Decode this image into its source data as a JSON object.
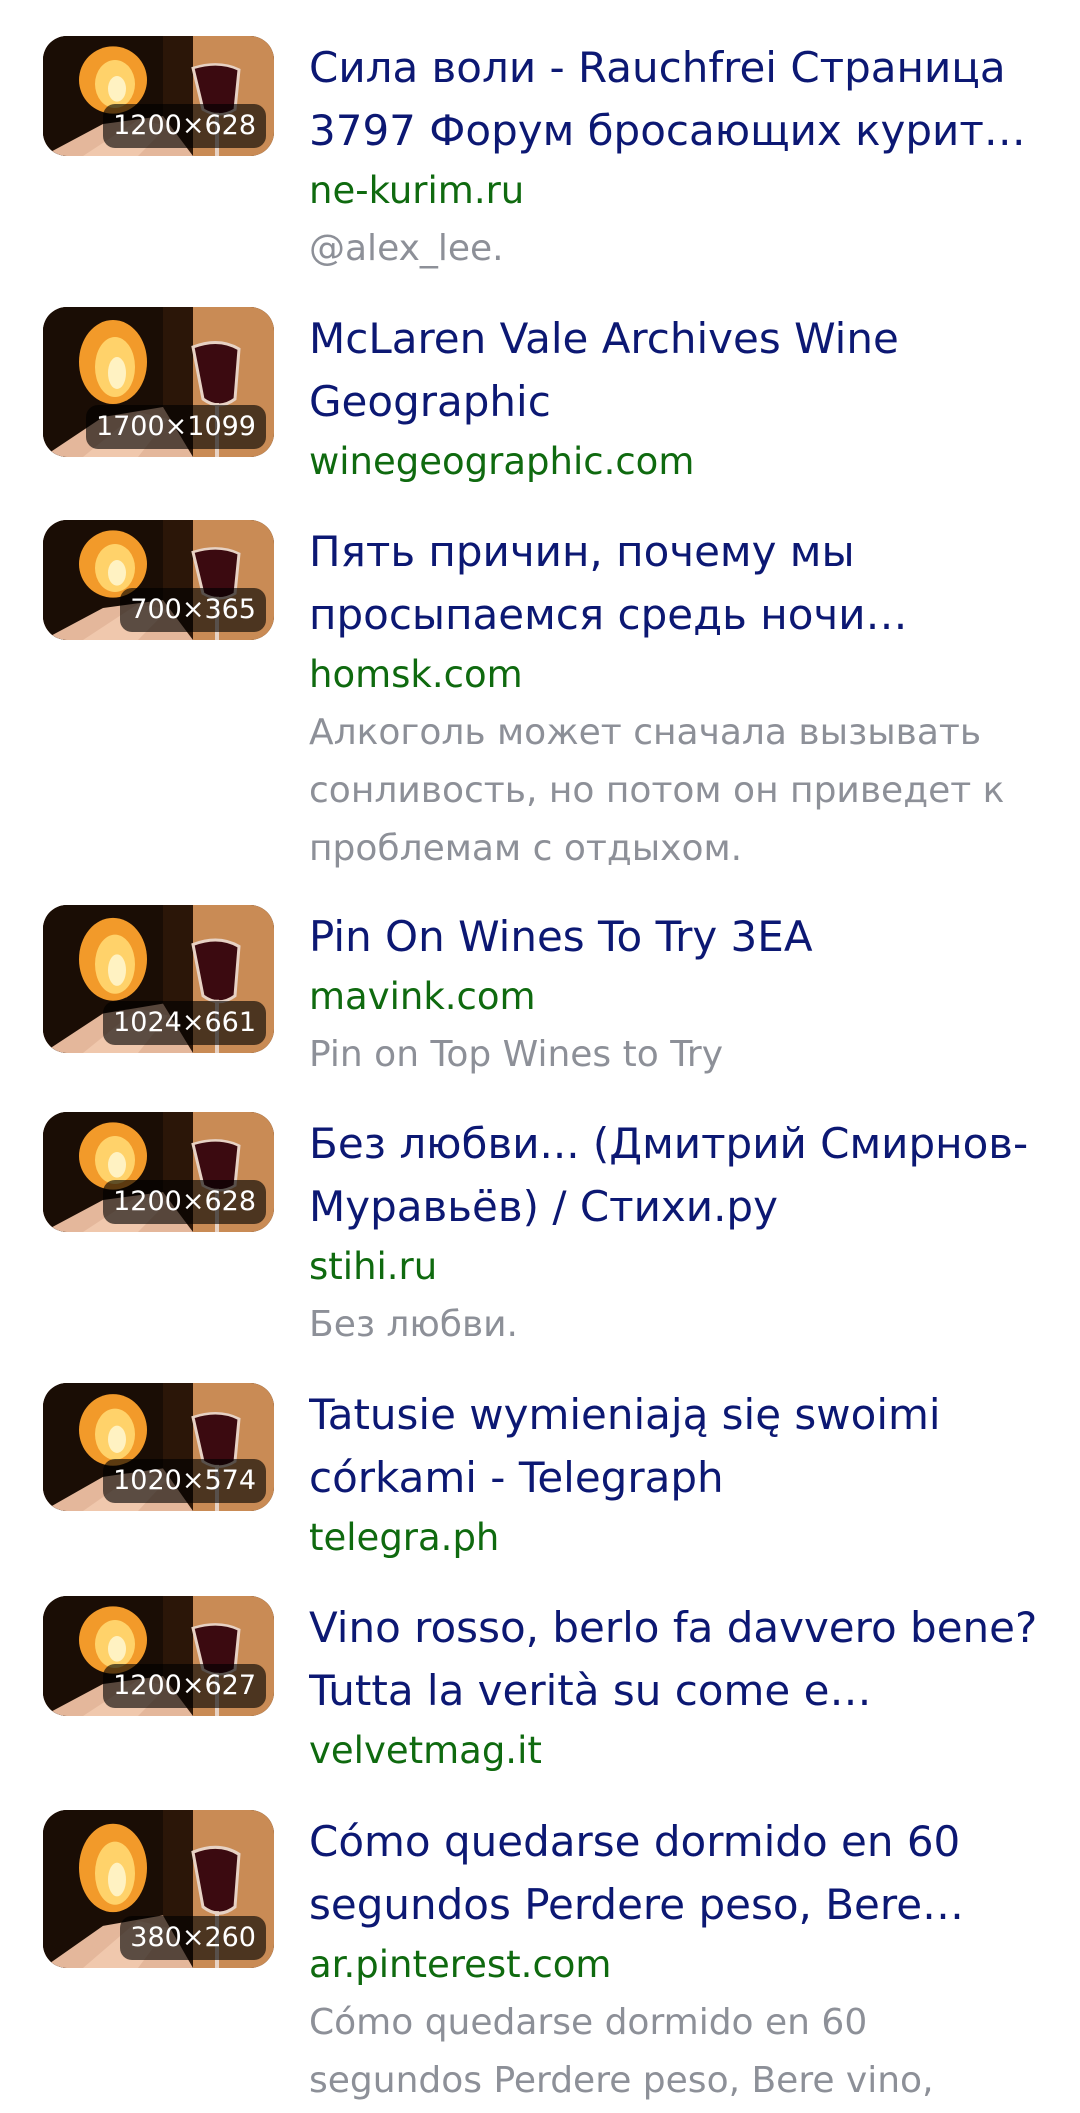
{
  "results": [
    {
      "title": "Сила воли - Rauchfrei Страница 3797 Форум бросающих курит…",
      "domain": "ne-kurim.ru",
      "description": "@alex_lee.",
      "dimensions": "1200×628"
    },
    {
      "title": "McLaren Vale Archives Wine Geographic",
      "domain": "winegeographic.com",
      "description": "",
      "dimensions": "1700×1099"
    },
    {
      "title": "Пять причин, почему мы просыпаемся средь ночи…",
      "domain": "homsk.com",
      "description": "Алкоголь может сначала вызывать сонливость, но потом он приведет к проблемам с отдыхом.",
      "dimensions": "700×365"
    },
    {
      "title": "Pin On Wines To Try 3EA",
      "domain": "mavink.com",
      "description": "Pin on Top Wines to Try",
      "dimensions": "1024×661"
    },
    {
      "title": "Без любви... (Дмитрий Смирнов-Муравьёв) / Стихи.ру",
      "domain": "stihi.ru",
      "description": "Без любви.",
      "dimensions": "1200×628"
    },
    {
      "title": "Tatusie wymieniają się swoimi córkami - Telegraph",
      "domain": "telegra.ph",
      "description": "",
      "dimensions": "1020×574"
    },
    {
      "title": "Vino rosso, berlo fa davvero bene? Tutta la verità su come e…",
      "domain": "velvetmag.it",
      "description": "",
      "dimensions": "1200×627"
    },
    {
      "title": "Cómo quedarse dormido en 60 segundos Perdere peso, Bere…",
      "domain": "ar.pinterest.com",
      "description": "Cómo quedarse dormido en 60 segundos Perdere peso, Bere vino,",
      "dimensions": "380×260"
    }
  ]
}
